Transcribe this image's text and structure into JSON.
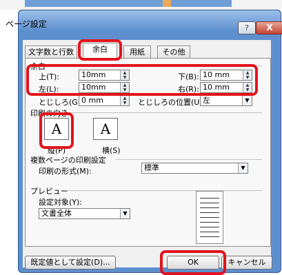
{
  "window": {
    "title": "ページ設定",
    "help": "?",
    "close": "X"
  },
  "tabs": [
    "文字数と行数",
    "余白",
    "用紙",
    "その他"
  ],
  "margins": {
    "group_label": "余白",
    "top_label": "上(T):",
    "top_value": "10mm",
    "bottom_label": "下(B):",
    "bottom_value": "10 mm",
    "left_label": "左(L):",
    "left_value": "10mm",
    "right_label": "右(R):",
    "right_value": "10 mm",
    "gutter_label": "とじしろ(G):",
    "gutter_value": "0 mm",
    "gutter_pos_label": "とじしろの位置(U):",
    "gutter_pos_value": "左"
  },
  "orientation": {
    "group_label": "印刷の向き",
    "portrait_label": "縦(P)",
    "landscape_label": "横(S)"
  },
  "multipage": {
    "group_label": "複数ページの印刷設定",
    "format_label": "印刷の形式(M):",
    "format_value": "標準"
  },
  "preview": {
    "group_label": "プレビュー",
    "apply_label": "設定対象(Y):",
    "apply_value": "文書全体"
  },
  "buttons": {
    "default": "既定値として設定(D)...",
    "ok": "OK",
    "cancel": "キャンセル"
  },
  "accent": "#e3131b"
}
